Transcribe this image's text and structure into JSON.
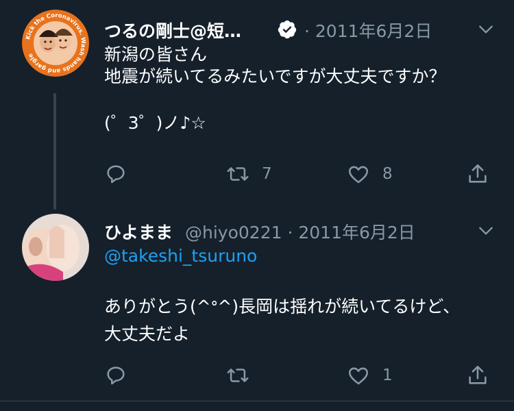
{
  "tweets": [
    {
      "name": "つるの剛士@短…",
      "verified": true,
      "separator": "·",
      "handle": "",
      "date": "2011年6月2日",
      "avatar_text": "Kick the Coronavirus. Wash hands and gargle",
      "lines": [
        "新潟の皆さん",
        "地震が続いてるみたいですが大丈夫ですか？",
        "",
        "(゜3゜)ノ♪☆"
      ],
      "reply_count": "",
      "retweet_count": "7",
      "like_count": "8"
    },
    {
      "name": "ひよまま",
      "verified": false,
      "separator": "·",
      "handle": "@hiyo0221",
      "date": "2011年6月2日",
      "mention": "@takeshi_tsuruno",
      "lines": [
        "",
        "ありがとう(^ᐤ^)長岡は揺れが続いてるけど、",
        "大丈夫だよ"
      ],
      "reply_count": "",
      "retweet_count": "",
      "like_count": "1"
    }
  ],
  "colors": {
    "background": "#15202b",
    "text": "#ffffff",
    "secondary": "#8899a6",
    "accent": "#1da1f2",
    "border": "#38444d",
    "avatar_ring": "#e8731c"
  },
  "icons": [
    "reply-icon",
    "retweet-icon",
    "like-icon",
    "share-icon",
    "verified-icon",
    "chevron-down-icon"
  ]
}
